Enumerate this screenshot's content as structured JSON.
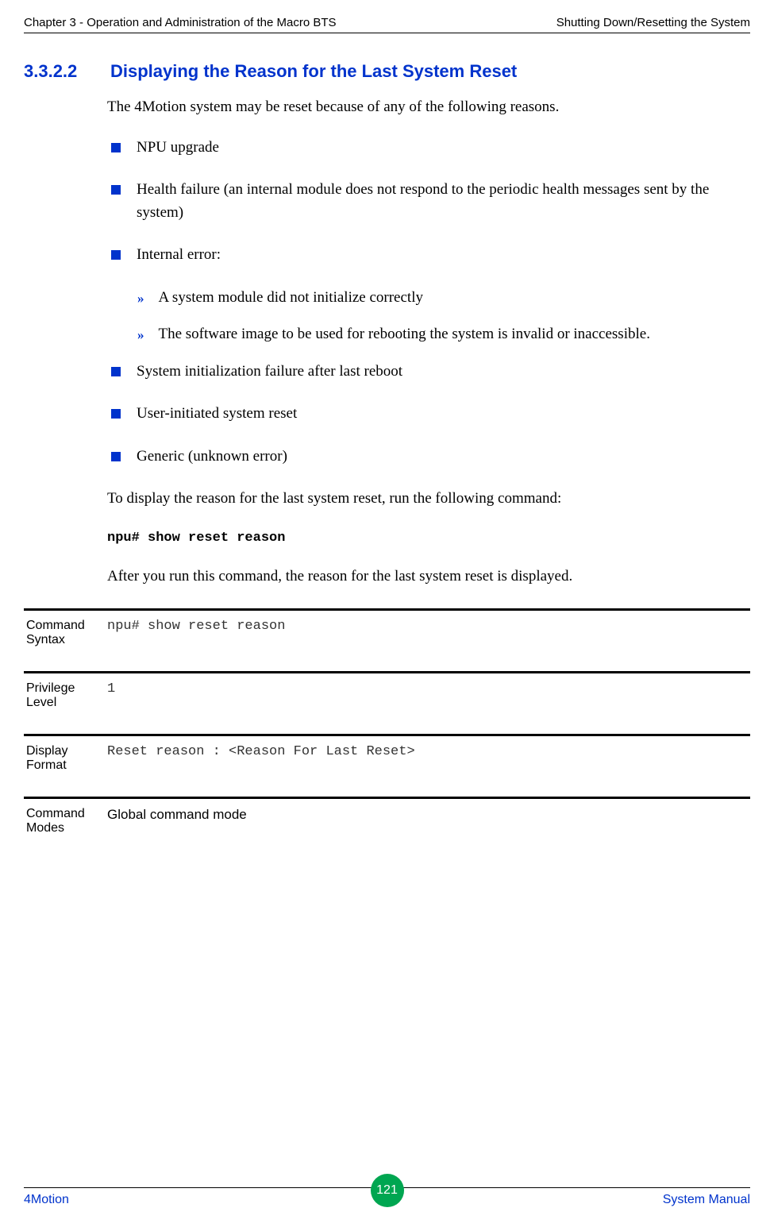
{
  "header": {
    "left": "Chapter 3 - Operation and Administration of the Macro BTS",
    "right": "Shutting Down/Resetting the System"
  },
  "section": {
    "number": "3.3.2.2",
    "title": "Displaying the Reason for the Last System Reset"
  },
  "intro": "The 4Motion system may be reset because of any of the following reasons.",
  "bullets": {
    "b0": "NPU upgrade",
    "b1": "Health failure (an internal module does not respond to the periodic health messages sent by the system)",
    "b2": "Internal error:",
    "b3": "System initialization failure after last reboot",
    "b4": "User-initiated system reset",
    "b5": "Generic (unknown error)"
  },
  "sub_bullets": {
    "s0": "A system module did not initialize correctly",
    "s1": "The software image to be used for rebooting the system is invalid or inaccessible."
  },
  "para2": "To display the reason for the last system reset, run the following command:",
  "command": "npu# show reset reason",
  "para3": "After you run this command, the reason for the last system reset is displayed.",
  "meta": {
    "command_syntax": {
      "label": "Command Syntax",
      "value": "npu# show reset reason"
    },
    "privilege_level": {
      "label": "Privilege Level",
      "value": "1"
    },
    "display_format": {
      "label": "Display Format",
      "value": "Reset reason : <Reason For Last Reset>"
    },
    "command_modes": {
      "label": "Command Modes",
      "value": "Global command mode"
    }
  },
  "footer": {
    "left": "4Motion",
    "page": "121",
    "right": "System Manual"
  }
}
